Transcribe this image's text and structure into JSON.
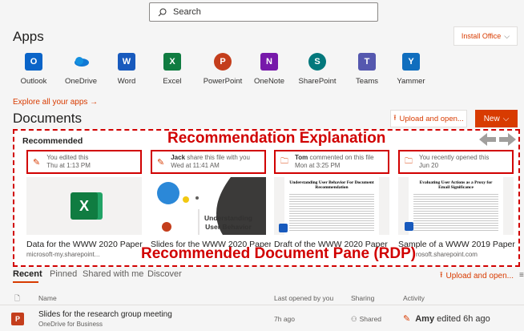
{
  "search": {
    "placeholder": "Search"
  },
  "apps_section": {
    "title": "Apps",
    "install_label": "Install Office",
    "explore_label": "Explore all your apps →",
    "apps": [
      {
        "label": "Outlook",
        "icon": "outlook-icon",
        "color": "#0a64c8",
        "letter": "O"
      },
      {
        "label": "OneDrive",
        "icon": "onedrive-icon",
        "color": "#1078d4",
        "letter": ""
      },
      {
        "label": "Word",
        "icon": "word-icon",
        "color": "#185abd",
        "letter": "W"
      },
      {
        "label": "Excel",
        "icon": "excel-icon",
        "color": "#107c41",
        "letter": "X"
      },
      {
        "label": "PowerPoint",
        "icon": "powerpoint-icon",
        "color": "#c43e1c",
        "letter": "P"
      },
      {
        "label": "OneNote",
        "icon": "onenote-icon",
        "color": "#7719aa",
        "letter": "N"
      },
      {
        "label": "SharePoint",
        "icon": "sharepoint-icon",
        "color": "#03787c",
        "letter": "S"
      },
      {
        "label": "Teams",
        "icon": "teams-icon",
        "color": "#5558af",
        "letter": "T"
      },
      {
        "label": "Yammer",
        "icon": "yammer-icon",
        "color": "#106ebe",
        "letter": "Y"
      }
    ]
  },
  "documents": {
    "title": "Documents",
    "upload_label": "Upload and open...",
    "new_label": "New"
  },
  "recommended": {
    "title": "Recommended",
    "explanation_annotation": "Recommendation Explanation",
    "pane_annotation": "Recommended Document Pane (RDP)",
    "cards": [
      {
        "activity_line1": "You edited this",
        "activity_line2": "Thu at 1:13 PM",
        "actor": "",
        "name": "Data for the WWW 2020 Paper",
        "location": "microsoft-my.sharepoint...",
        "icon": "pencil-icon"
      },
      {
        "actor": "Jack",
        "activity_line1": " share this file with you",
        "activity_line2": "Wed at 11:41 AM",
        "name": "Slides for the WWW 2020 Paper",
        "location": "",
        "icon": "pencil-icon",
        "thumb_text": "Understanding User Behavior"
      },
      {
        "actor": "Tom",
        "activity_line1": " commented on this file",
        "activity_line2": "Mon at 3:25 PM",
        "name": "Draft of the WWW 2020 Paper",
        "location": "",
        "icon": "folder-icon",
        "thumb_text": "Understanding User Behavior For Document Recommendation"
      },
      {
        "actor": "",
        "activity_line1": "You recently opened this",
        "activity_line2": "Jun 20",
        "name": "Sample of a WWW 2019 Paper",
        "location": "rosoft.sharepoint.com",
        "icon": "folder-icon",
        "thumb_text": "Evaluating User Actions as a Proxy for Email Significance"
      }
    ]
  },
  "tabs": [
    "Recent",
    "Pinned",
    "Shared with me",
    "Discover"
  ],
  "list": {
    "upload_label": "Upload and open...",
    "headers": {
      "name": "Name",
      "last_opened": "Last opened by you",
      "sharing": "Sharing",
      "activity": "Activity"
    },
    "rows": [
      {
        "name": "Slides for the research group meeting",
        "location": "OneDrive for Business",
        "last_opened": "7h ago",
        "sharing": "Shared",
        "activity_actor": "Amy",
        "activity_text": " edited 6h ago"
      }
    ]
  },
  "colors": {
    "accent": "#d83b01",
    "annotation": "#d10000"
  }
}
